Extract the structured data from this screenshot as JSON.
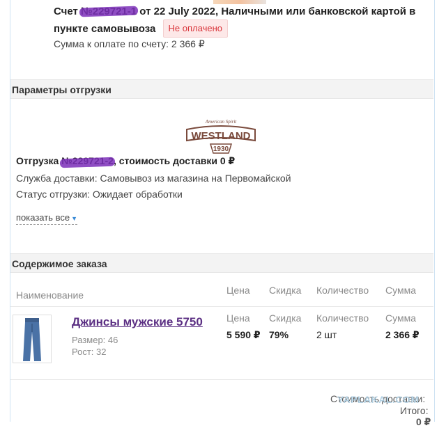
{
  "invoice": {
    "prefix": "Счет ",
    "number_redacted": "№229721-1",
    "suffix": " от 22 July 2022, Наличными или банковской картой в пункте самовывоза",
    "status_badge": "Не оплачено",
    "sum_label": "Сумма к оплате по счету: 2 366 ₽"
  },
  "shipment_section": {
    "title": "Параметры отгрузки",
    "logo_text": "WESTLAND",
    "logo_top": "American Spirit",
    "logo_year": "1930",
    "shipment_prefix": "Отгрузка ",
    "shipment_number_redacted": "№229721-2",
    "shipment_suffix": ", стоимость доставки 0 ₽",
    "delivery_service": "Служба доставки: Самовывоз из магазина на Первомайской",
    "status": "Статус отгрузки: Ожидает обработки",
    "show_all": "показать все"
  },
  "order_section": {
    "title": "Содержимое заказа",
    "columns": {
      "name": "Наименование",
      "price": "Цена",
      "discount": "Скидка",
      "quantity": "Количество",
      "sum": "Сумма"
    },
    "item": {
      "name": "Джинсы мужские 5750",
      "size": "Размер: 46",
      "height": "Рост: 32",
      "price_label": "Цена",
      "discount_label": "Скидка",
      "quantity_label": "Количество",
      "sum_label": "Сумма",
      "price": "5 590 ₽",
      "discount": "79%",
      "quantity": "2  шт",
      "sum": "2 366 ₽"
    }
  },
  "footer": {
    "delivery_cost": "Стоимость доставки:",
    "total": "Итого:",
    "total_value": "0 ₽",
    "watermark": "YAPLAKAL.COM"
  }
}
